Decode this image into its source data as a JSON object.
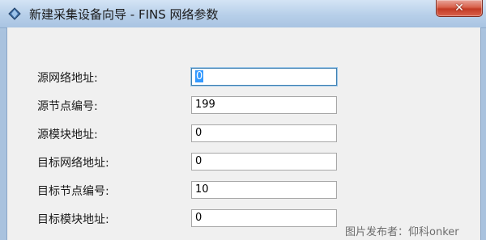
{
  "window": {
    "title": "新建采集设备向导 - FINS 网络参数",
    "close_label": "✕"
  },
  "form": {
    "fields": [
      {
        "label": "源网络地址:",
        "value": "0"
      },
      {
        "label": "源节点编号:",
        "value": "199"
      },
      {
        "label": "源模块地址:",
        "value": "0"
      },
      {
        "label": "目标网络地址:",
        "value": "0"
      },
      {
        "label": "目标节点编号:",
        "value": "10"
      },
      {
        "label": "目标模块地址:",
        "value": "0"
      }
    ]
  },
  "watermark": "图片发布者：仰科onker",
  "icons": {
    "app": "wizard-diamond-icon",
    "close": "close-icon"
  },
  "colors": {
    "titlebar": "#b7cfe9",
    "close_button": "#c33b25",
    "client_background": "#f0f0f0",
    "focus_border": "#3c7fb1"
  }
}
